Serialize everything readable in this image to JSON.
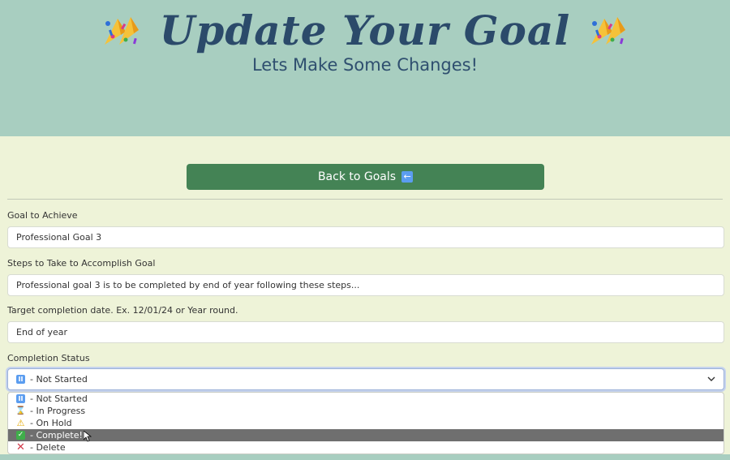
{
  "header": {
    "title": "Update Your Goal",
    "subtitle": "Lets Make Some Changes!",
    "decoration_icon": "confetti-icon"
  },
  "back_button": {
    "label": "Back to Goals",
    "icon": "back-arrow-icon"
  },
  "form": {
    "goal": {
      "label": "Goal to Achieve",
      "value": "Professional Goal 3"
    },
    "steps": {
      "label": "Steps to Take to Accomplish Goal",
      "value": "Professional goal 3 is to be completed by end of year following these steps..."
    },
    "target": {
      "label": "Target completion date. Ex. 12/01/24 or Year round.",
      "value": "End of year"
    },
    "status": {
      "label": "Completion Status",
      "selected": "- Not Started",
      "selected_icon": "pause-icon",
      "options": [
        {
          "label": "- Not Started",
          "icon": "pause-icon"
        },
        {
          "label": "- In Progress",
          "icon": "hourglass-icon"
        },
        {
          "label": "- On Hold",
          "icon": "warning-icon"
        },
        {
          "label": "- Complete!",
          "icon": "check-mark-icon",
          "highlighted": true
        },
        {
          "label": "- Delete",
          "icon": "cross-mark-icon"
        }
      ]
    }
  },
  "colors": {
    "header_bg": "#a8cec0",
    "page_bg": "#eef3d8",
    "button_bg": "#448355",
    "title_color": "#2b4a6a",
    "highlight_bg": "#6f6f6f"
  }
}
